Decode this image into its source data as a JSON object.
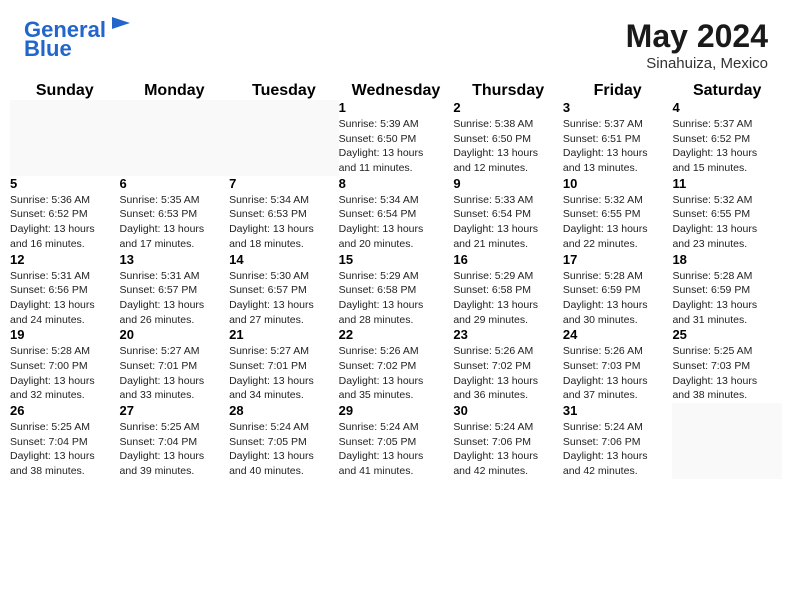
{
  "header": {
    "logo_general": "General",
    "logo_blue": "Blue",
    "month_year": "May 2024",
    "location": "Sinahuiza, Mexico"
  },
  "weekdays": [
    "Sunday",
    "Monday",
    "Tuesday",
    "Wednesday",
    "Thursday",
    "Friday",
    "Saturday"
  ],
  "weeks": [
    [
      {
        "day": "",
        "info": ""
      },
      {
        "day": "",
        "info": ""
      },
      {
        "day": "",
        "info": ""
      },
      {
        "day": "1",
        "info": "Sunrise: 5:39 AM\nSunset: 6:50 PM\nDaylight: 13 hours\nand 11 minutes."
      },
      {
        "day": "2",
        "info": "Sunrise: 5:38 AM\nSunset: 6:50 PM\nDaylight: 13 hours\nand 12 minutes."
      },
      {
        "day": "3",
        "info": "Sunrise: 5:37 AM\nSunset: 6:51 PM\nDaylight: 13 hours\nand 13 minutes."
      },
      {
        "day": "4",
        "info": "Sunrise: 5:37 AM\nSunset: 6:52 PM\nDaylight: 13 hours\nand 15 minutes."
      }
    ],
    [
      {
        "day": "5",
        "info": "Sunrise: 5:36 AM\nSunset: 6:52 PM\nDaylight: 13 hours\nand 16 minutes."
      },
      {
        "day": "6",
        "info": "Sunrise: 5:35 AM\nSunset: 6:53 PM\nDaylight: 13 hours\nand 17 minutes."
      },
      {
        "day": "7",
        "info": "Sunrise: 5:34 AM\nSunset: 6:53 PM\nDaylight: 13 hours\nand 18 minutes."
      },
      {
        "day": "8",
        "info": "Sunrise: 5:34 AM\nSunset: 6:54 PM\nDaylight: 13 hours\nand 20 minutes."
      },
      {
        "day": "9",
        "info": "Sunrise: 5:33 AM\nSunset: 6:54 PM\nDaylight: 13 hours\nand 21 minutes."
      },
      {
        "day": "10",
        "info": "Sunrise: 5:32 AM\nSunset: 6:55 PM\nDaylight: 13 hours\nand 22 minutes."
      },
      {
        "day": "11",
        "info": "Sunrise: 5:32 AM\nSunset: 6:55 PM\nDaylight: 13 hours\nand 23 minutes."
      }
    ],
    [
      {
        "day": "12",
        "info": "Sunrise: 5:31 AM\nSunset: 6:56 PM\nDaylight: 13 hours\nand 24 minutes."
      },
      {
        "day": "13",
        "info": "Sunrise: 5:31 AM\nSunset: 6:57 PM\nDaylight: 13 hours\nand 26 minutes."
      },
      {
        "day": "14",
        "info": "Sunrise: 5:30 AM\nSunset: 6:57 PM\nDaylight: 13 hours\nand 27 minutes."
      },
      {
        "day": "15",
        "info": "Sunrise: 5:29 AM\nSunset: 6:58 PM\nDaylight: 13 hours\nand 28 minutes."
      },
      {
        "day": "16",
        "info": "Sunrise: 5:29 AM\nSunset: 6:58 PM\nDaylight: 13 hours\nand 29 minutes."
      },
      {
        "day": "17",
        "info": "Sunrise: 5:28 AM\nSunset: 6:59 PM\nDaylight: 13 hours\nand 30 minutes."
      },
      {
        "day": "18",
        "info": "Sunrise: 5:28 AM\nSunset: 6:59 PM\nDaylight: 13 hours\nand 31 minutes."
      }
    ],
    [
      {
        "day": "19",
        "info": "Sunrise: 5:28 AM\nSunset: 7:00 PM\nDaylight: 13 hours\nand 32 minutes."
      },
      {
        "day": "20",
        "info": "Sunrise: 5:27 AM\nSunset: 7:01 PM\nDaylight: 13 hours\nand 33 minutes."
      },
      {
        "day": "21",
        "info": "Sunrise: 5:27 AM\nSunset: 7:01 PM\nDaylight: 13 hours\nand 34 minutes."
      },
      {
        "day": "22",
        "info": "Sunrise: 5:26 AM\nSunset: 7:02 PM\nDaylight: 13 hours\nand 35 minutes."
      },
      {
        "day": "23",
        "info": "Sunrise: 5:26 AM\nSunset: 7:02 PM\nDaylight: 13 hours\nand 36 minutes."
      },
      {
        "day": "24",
        "info": "Sunrise: 5:26 AM\nSunset: 7:03 PM\nDaylight: 13 hours\nand 37 minutes."
      },
      {
        "day": "25",
        "info": "Sunrise: 5:25 AM\nSunset: 7:03 PM\nDaylight: 13 hours\nand 38 minutes."
      }
    ],
    [
      {
        "day": "26",
        "info": "Sunrise: 5:25 AM\nSunset: 7:04 PM\nDaylight: 13 hours\nand 38 minutes."
      },
      {
        "day": "27",
        "info": "Sunrise: 5:25 AM\nSunset: 7:04 PM\nDaylight: 13 hours\nand 39 minutes."
      },
      {
        "day": "28",
        "info": "Sunrise: 5:24 AM\nSunset: 7:05 PM\nDaylight: 13 hours\nand 40 minutes."
      },
      {
        "day": "29",
        "info": "Sunrise: 5:24 AM\nSunset: 7:05 PM\nDaylight: 13 hours\nand 41 minutes."
      },
      {
        "day": "30",
        "info": "Sunrise: 5:24 AM\nSunset: 7:06 PM\nDaylight: 13 hours\nand 42 minutes."
      },
      {
        "day": "31",
        "info": "Sunrise: 5:24 AM\nSunset: 7:06 PM\nDaylight: 13 hours\nand 42 minutes."
      },
      {
        "day": "",
        "info": ""
      }
    ]
  ]
}
